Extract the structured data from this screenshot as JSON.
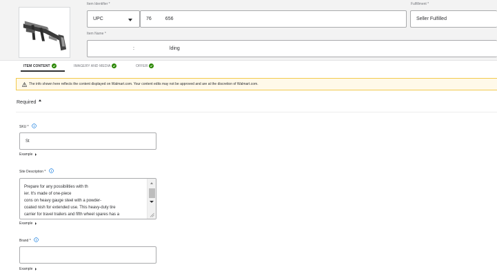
{
  "header": {
    "item_identifier_label": "Item Identifier *",
    "identifier_type": "UPC",
    "identifier_value_prefix": "76",
    "identifier_value_suffix": "656",
    "fulfillment_label": "Fulfillment *",
    "fulfillment_value": "Seller Fulfilled",
    "item_name_label": "Item Name *",
    "item_name_fragment_1": ":",
    "item_name_fragment_2": "lding"
  },
  "tabs": [
    {
      "label": "ITEM CONTENT",
      "active": true,
      "complete": true
    },
    {
      "label": "IMAGERY AND MEDIA",
      "active": false,
      "complete": true
    },
    {
      "label": "OFFER",
      "active": false,
      "complete": true
    }
  ],
  "warning": {
    "text": "The info shown here reflects the content displayed on Walmart.com. Your content edits may not be approved and are at the discretion of Walmart.com."
  },
  "section": {
    "title": "Required"
  },
  "fields": {
    "sku": {
      "label": "SKU *",
      "value": "St",
      "example": "Example"
    },
    "site_description": {
      "label": "Site Description *",
      "value": "Prepare for any possibilities with th\n      ier. It's made of one-piece\ncons     on heavy gauge steel with a powder-\ncoated  nish for extended use. This heavy-duty tire\ncarrier for travel trailers and fifth wheel spares has a",
      "example": "Example"
    },
    "brand": {
      "label": "Brand *",
      "value": "",
      "example": "Example"
    }
  },
  "colors": {
    "success": "#2a8703",
    "warning_bg": "#fff9e9",
    "warning_border": "#f2c94c",
    "info_blue": "#0071dc"
  }
}
